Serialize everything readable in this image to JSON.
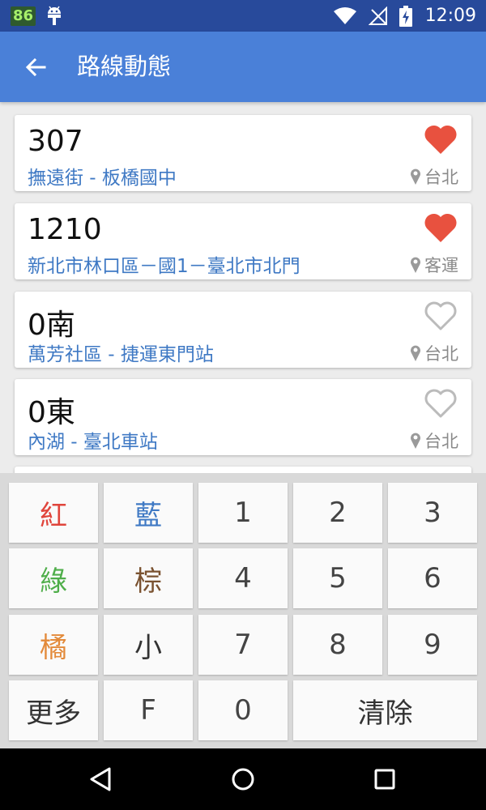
{
  "status_bar": {
    "badge": "86",
    "time": "12:09"
  },
  "app_bar": {
    "title": "路線動態"
  },
  "routes": [
    {
      "number": "307",
      "description": "撫遠街 - 板橋國中",
      "location": "台北",
      "favorite": true
    },
    {
      "number": "1210",
      "description": "新北市林口區－國1－臺北市北門",
      "location": "客運",
      "favorite": true
    },
    {
      "number": "0南",
      "description": "萬芳社區 - 捷運東門站",
      "location": "台北",
      "favorite": false
    },
    {
      "number": "0東",
      "description": "內湖 - 臺北車站",
      "location": "台北",
      "favorite": false
    }
  ],
  "keypad": {
    "keys": [
      {
        "label": "紅",
        "color": "#e0453c"
      },
      {
        "label": "藍",
        "color": "#3f79c4"
      },
      {
        "label": "1",
        "color": "#444444"
      },
      {
        "label": "2",
        "color": "#444444"
      },
      {
        "label": "3",
        "color": "#444444"
      },
      {
        "label": "綠",
        "color": "#4fae4a"
      },
      {
        "label": "棕",
        "color": "#7a5230"
      },
      {
        "label": "4",
        "color": "#444444"
      },
      {
        "label": "5",
        "color": "#444444"
      },
      {
        "label": "6",
        "color": "#444444"
      },
      {
        "label": "橘",
        "color": "#e38a3a"
      },
      {
        "label": "小",
        "color": "#333333"
      },
      {
        "label": "7",
        "color": "#444444"
      },
      {
        "label": "8",
        "color": "#444444"
      },
      {
        "label": "9",
        "color": "#444444"
      },
      {
        "label": "更多",
        "color": "#333333"
      },
      {
        "label": "F",
        "color": "#444444"
      },
      {
        "label": "0",
        "color": "#444444"
      },
      {
        "label": "清除",
        "color": "#333333"
      }
    ]
  },
  "colors": {
    "status_bar": "#284a9b",
    "app_bar": "#4a80d8",
    "route_desc": "#3f79c4",
    "favorite_on": "#e8513f",
    "favorite_off": "#bbbbbb"
  },
  "icons": {
    "back": "arrow-left-icon",
    "favorite": "heart-icon",
    "location": "map-pin-icon",
    "nav_back": "triangle-back-icon",
    "nav_home": "circle-home-icon",
    "nav_recent": "square-recent-icon"
  }
}
